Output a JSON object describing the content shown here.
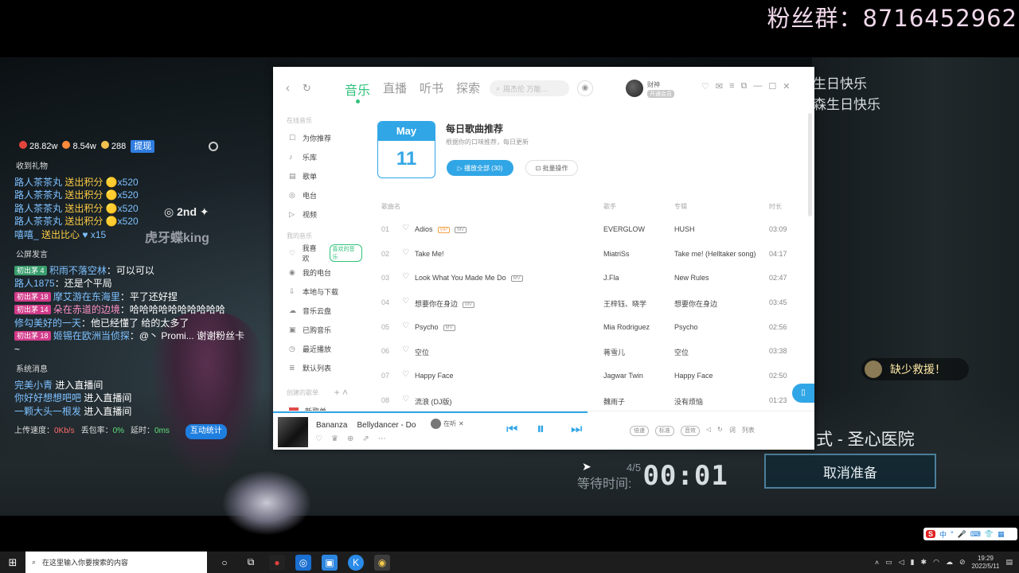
{
  "banner": {
    "fan_group": "粉丝群：8716452962"
  },
  "stats": {
    "popularity": "28.82w",
    "fans": "8.54w",
    "subs": "288",
    "tag": "提现"
  },
  "chat": {
    "gift_title": "收到礼物",
    "gifts": [
      {
        "user": "路人茶茶丸",
        "action": "送出积分",
        "count": "x520"
      },
      {
        "user": "路人茶茶丸",
        "action": "送出积分",
        "count": "x520"
      },
      {
        "user": "路人茶茶丸",
        "action": "送出积分",
        "count": "x520"
      },
      {
        "user": "路人茶茶丸",
        "action": "送出积分",
        "count": "x520"
      },
      {
        "user": "嘻嘻_",
        "action": "送出比心",
        "count": "x15"
      }
    ],
    "public_title": "公屏发言",
    "messages": [
      {
        "badge": "初出茅 4",
        "user": "积雨不落空林",
        "text": "：可以可以"
      },
      {
        "badge": "",
        "user": "路人1875",
        "text": "：还是个平局"
      },
      {
        "badge": "初出茅 18",
        "user": "摩艾游在东海里",
        "text": "：平了还好捏"
      },
      {
        "badge": "初出茅 14",
        "user": "朵在赤道的边境",
        "text": "：哈哈哈哈哈哈哈哈哈哈"
      },
      {
        "badge": "",
        "user": "修勾美好的一天",
        "text": "：他已经懂了 给的太多了"
      },
      {
        "badge": "初出茅 18",
        "user": "姬锡在欧洲当侦探",
        "text": "：@丶 Promi... 谢谢粉丝卡~"
      }
    ],
    "system_title": "系统消息",
    "system": [
      {
        "user": "完美小青",
        "text": " 进入直播间"
      },
      {
        "user": "你好好想想吧吧",
        "text": " 进入直播间"
      },
      {
        "user": "一颗大头一根发",
        "text": " 进入直播间"
      }
    ],
    "upload_label": "上传速度：",
    "upload": "0Kb/s",
    "loss_label": "丢包率：",
    "loss": "0%",
    "latency_label": "延时：",
    "latency": "0ms",
    "interact_btn": "互动统计"
  },
  "rank_badge": "2nd",
  "watermark": "虎牙蝶king",
  "game": {
    "notice_1": "生日快乐",
    "notice_2": "森生日快乐",
    "rescue": "缺少救援！",
    "mode": "式 - 圣心医院",
    "cancel": "取消准备",
    "wait_label": "等待时间:",
    "wait_count": "4/5",
    "wait_time": "00:01"
  },
  "music": {
    "tabs": [
      "音乐",
      "直播",
      "听书",
      "探索"
    ],
    "search_placeholder": "周杰伦 万能…",
    "user_name": "财神",
    "user_vip": "开通会员",
    "sidebar_group_1": "在线音乐",
    "sidebar_online": [
      "为你推荐",
      "乐库",
      "歌单",
      "电台",
      "视频"
    ],
    "sidebar_group_2": "我的音乐",
    "sidebar_mine": [
      "我喜欢",
      "我的电台",
      "本地与下载",
      "音乐云盘",
      "已购音乐",
      "最近播放",
      "默认列表"
    ],
    "sidebar_pill": "喜欢的音乐",
    "sidebar_group_3": "创建的歌单",
    "sidebar_last": "新歌单",
    "cal_month": "May",
    "cal_day": "11",
    "daily_title": "每日歌曲推荐",
    "daily_sub": "根据你的口味推荐，每日更新",
    "play_all": "播放全部 (30)",
    "batch": "批量操作",
    "col_song": "歌曲名",
    "col_artist": "歌手",
    "col_album": "专辑",
    "col_dur": "时长",
    "songs": [
      {
        "no": "01",
        "title": "Adios",
        "tags": [
          "VIP",
          "MV"
        ],
        "artist": "EVERGLOW",
        "album": "HUSH",
        "dur": "03:09"
      },
      {
        "no": "02",
        "title": "Take Me!",
        "tags": [],
        "artist": "MiatriSs",
        "album": "Take me! (Helltaker song)",
        "dur": "04:17"
      },
      {
        "no": "03",
        "title": "Look What You Made Me Do",
        "tags": [
          "MV"
        ],
        "artist": "J.Fla",
        "album": "New Rules",
        "dur": "02:47"
      },
      {
        "no": "04",
        "title": "想要你在身边",
        "tags": [
          "MV"
        ],
        "artist": "王梓钰、晓学",
        "album": "想要你在身边",
        "dur": "03:45"
      },
      {
        "no": "05",
        "title": "Psycho",
        "tags": [
          "MV"
        ],
        "artist": "Mia Rodriguez",
        "album": "Psycho",
        "dur": "02:56"
      },
      {
        "no": "06",
        "title": "空位",
        "tags": [],
        "artist": "蒋雪儿",
        "album": "空位",
        "dur": "03:38"
      },
      {
        "no": "07",
        "title": "Happy Face",
        "tags": [],
        "artist": "Jagwar Twin",
        "album": "Happy Face",
        "dur": "02:50"
      },
      {
        "no": "08",
        "title": "流浪 (DJ版)",
        "tags": [],
        "artist": "魏雨子",
        "album": "没有烦恼",
        "dur": "01:23"
      }
    ],
    "player": {
      "song": "Bananza",
      "artist": "Bellydancer - Do",
      "listen": "在听",
      "quality": "标准",
      "effect": "音效",
      "lyrics": "词",
      "list": "列表",
      "speed": "倍速"
    }
  },
  "taskbar": {
    "search_placeholder": "在这里输入你要搜索的内容",
    "time": "19:29",
    "date": "2022/5/11"
  },
  "ime": {
    "lang": "中"
  }
}
